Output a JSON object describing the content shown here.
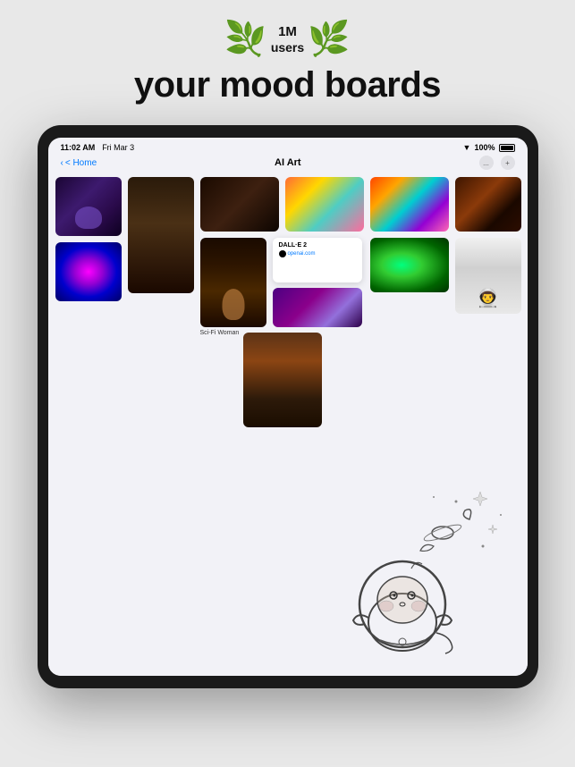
{
  "badge": {
    "number": "1M",
    "label": "users"
  },
  "headline": "your mood boards",
  "ipad": {
    "status_bar": {
      "time": "11:02 AM",
      "date": "Fri Mar 3",
      "battery": "100%",
      "wifi_icon": "wifi"
    },
    "nav": {
      "back_label": "< Home",
      "title": "AI Art",
      "dots": "...",
      "add_icon": "+"
    },
    "tile_labels": {
      "sci_fi_woman": "Sci-Fi Woman",
      "dalle": "DALL·E 2",
      "dalle_url": "openai.com"
    }
  }
}
